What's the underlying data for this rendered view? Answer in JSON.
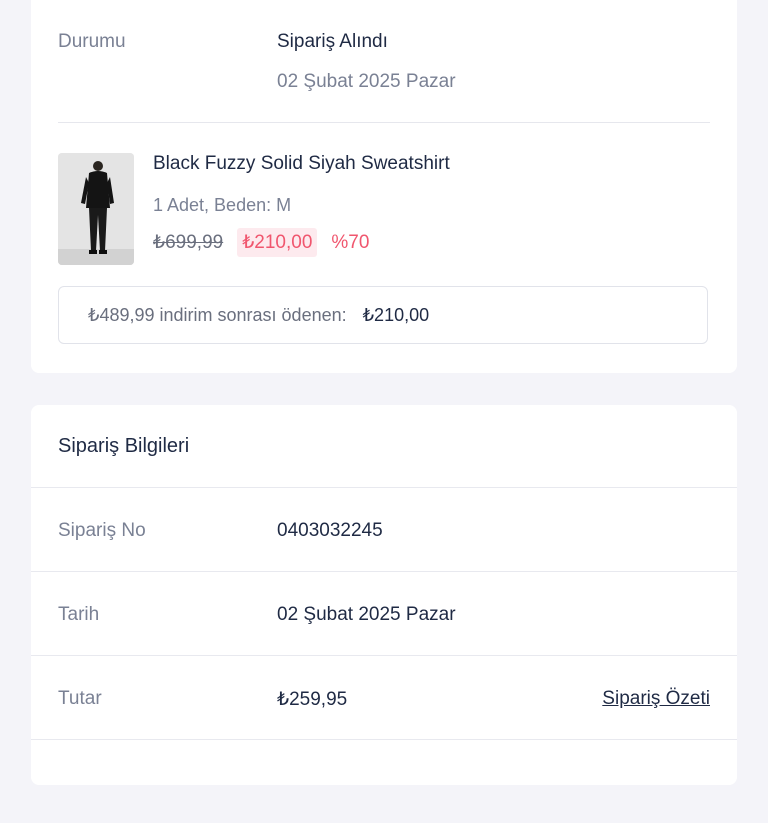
{
  "status": {
    "label": "Durumu",
    "value": "Sipariş Alındı",
    "date": "02 Şubat 2025 Pazar"
  },
  "product": {
    "name": "Black Fuzzy Solid Siyah Sweatshirt",
    "meta": "1 Adet, Beden: M",
    "price_old": "₺699,99",
    "price_new": "₺210,00",
    "discount": "%70",
    "image_icon": "product-photo"
  },
  "summary": {
    "text": "₺489,99 indirim sonrası ödenen:",
    "amount": "₺210,00"
  },
  "order_info": {
    "title": "Sipariş Bilgileri",
    "rows": [
      {
        "label": "Sipariş No",
        "value": "0403032245"
      },
      {
        "label": "Tarih",
        "value": "02 Şubat 2025 Pazar"
      },
      {
        "label": "Tutar",
        "value": "₺259,95",
        "link": "Sipariş Özeti"
      }
    ]
  },
  "colors": {
    "accent_red": "#f0566e",
    "background": "#f4f4f9",
    "text_primary": "#1f2a44",
    "text_muted": "#7a8194"
  }
}
